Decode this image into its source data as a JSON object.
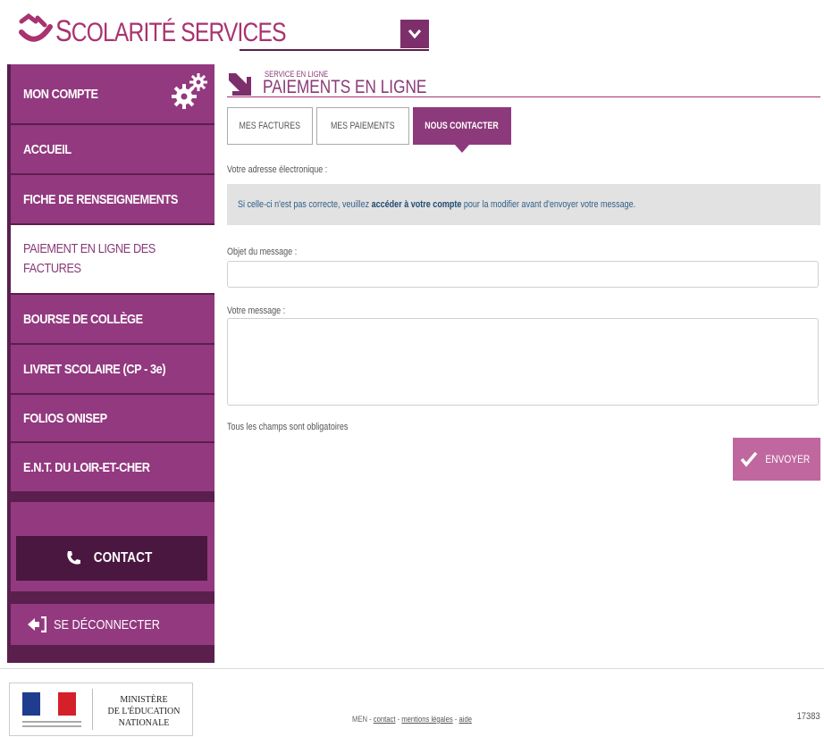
{
  "app": {
    "title_first": "S",
    "title_rest": "COLARITÉ SERVICES",
    "brand_color": "#a8336f"
  },
  "sidebar": {
    "account_label": "MON COMPTE",
    "items": [
      {
        "label": "ACCUEIL"
      },
      {
        "label": "FICHE DE RENSEIGNEMENTS"
      },
      {
        "label": "PAIEMENT EN LIGNE DES FACTURES",
        "active": true
      },
      {
        "label": "BOURSE DE COLLÈGE"
      },
      {
        "label": "LIVRET SCOLAIRE (CP - 3e)"
      },
      {
        "label": "FOLIOS ONISEP"
      },
      {
        "label": "E.N.T. DU LOIR-ET-CHER"
      }
    ],
    "contact_label": "CONTACT",
    "logout_label": "SE DÉCONNECTER"
  },
  "main": {
    "service_label": "SERVICE EN LIGNE",
    "page_title": "PAIEMENTS EN LIGNE",
    "tabs": [
      {
        "label": "MES FACTURES"
      },
      {
        "label": "MES PAIEMENTS"
      },
      {
        "label": "NOUS CONTACTER",
        "active": true
      }
    ],
    "email_label": "Votre adresse électronique :",
    "info_prefix": "Si celle-ci n'est pas correcte, veuillez ",
    "info_link": "accéder à votre compte",
    "info_suffix": " pour la modifier avant d'envoyer votre message.",
    "subject_label": "Objet du message :",
    "subject_value": "",
    "message_label": "Votre message :",
    "message_value": "",
    "required_note": "Tous les champs sont obligatoires",
    "send_label": "ENVOYER"
  },
  "footer": {
    "ministry_line1": "MINISTÈRE",
    "ministry_line2": "DE L'ÉDUCATION",
    "ministry_line3": "NATIONALE",
    "links_prefix": "MEN - ",
    "link_contact": "contact",
    "sep1": " - ",
    "link_legal": "mentions légales",
    "sep2": " - ",
    "link_help": "aide",
    "code": "17383"
  }
}
